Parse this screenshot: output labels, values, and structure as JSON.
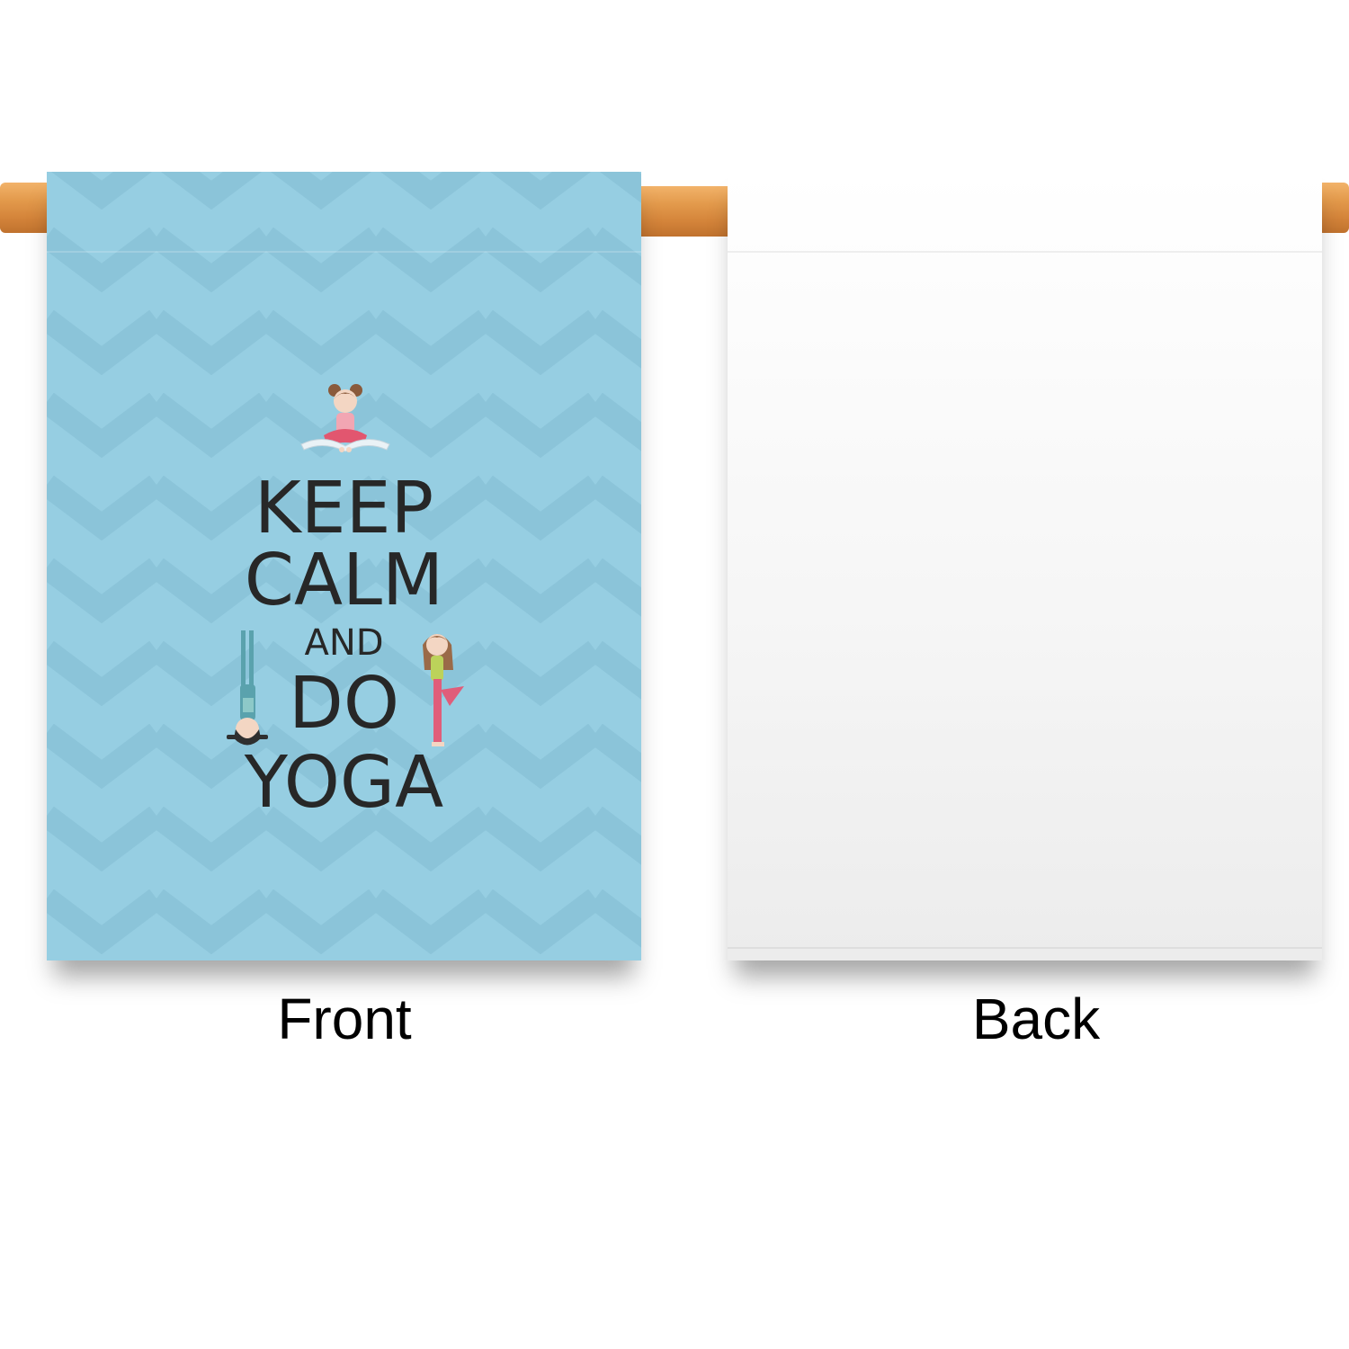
{
  "front_flag": {
    "background_color": "#96cee2",
    "chevron_color": "#8bc3d8",
    "lines": {
      "keep": "KEEP",
      "calm": "CALM",
      "and": "AND",
      "do": "DO",
      "yoga": "YOGA"
    },
    "text_color": "#272727"
  },
  "back_flag": {
    "background_color": "#f3f3f3"
  },
  "rod_color": "#d98d42",
  "captions": {
    "front": "Front",
    "back": "Back"
  }
}
